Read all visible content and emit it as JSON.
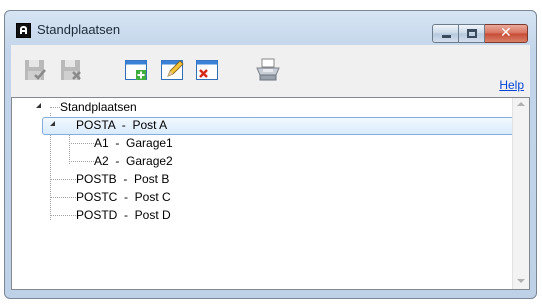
{
  "window": {
    "title": "Standplaatsen"
  },
  "toolbar": {
    "help_label": "Help",
    "icons": [
      "save-check-icon",
      "save-cancel-icon",
      "new-window-icon",
      "edit-icon",
      "delete-window-icon",
      "printer-icon"
    ]
  },
  "tree": {
    "root": "Standplaatsen",
    "nodes": [
      {
        "label": "POSTA  -  Post A",
        "expanded": true,
        "selected": true
      },
      {
        "label": "A1  -  Garage1"
      },
      {
        "label": "A2  -  Garage2"
      },
      {
        "label": "POSTB  -  Post B"
      },
      {
        "label": "POSTC  -  Post C"
      },
      {
        "label": "POSTD  -  Post D"
      }
    ]
  },
  "colors": {
    "selection_border": "#84acdd",
    "link": "#0645d6",
    "close_button": "#c74a33"
  }
}
